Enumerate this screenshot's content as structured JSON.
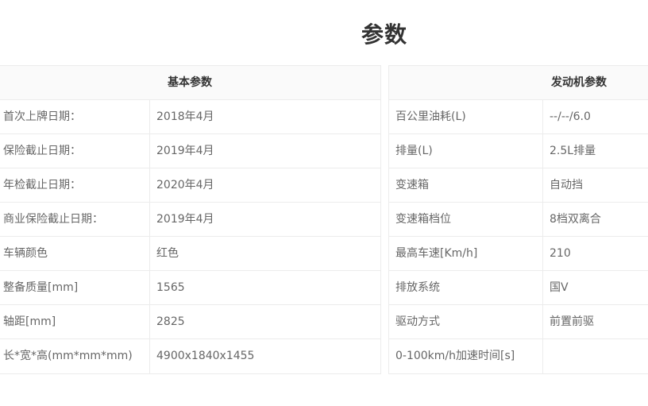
{
  "page_title": "参数",
  "basic": {
    "header": "基本参数",
    "rows": [
      {
        "label": "首次上牌日期：",
        "value": "2018年4月"
      },
      {
        "label": "保险截止日期：",
        "value": "2019年4月"
      },
      {
        "label": "年检截止日期：",
        "value": "2020年4月"
      },
      {
        "label": "商业保险截止日期：",
        "value": "2019年4月"
      },
      {
        "label": "车辆颜色",
        "value": "红色"
      },
      {
        "label": "整备质量[mm]",
        "value": "1565"
      },
      {
        "label": "轴距[mm]",
        "value": "2825"
      },
      {
        "label": "长*宽*高(mm*mm*mm)",
        "value": "4900x1840x1455"
      }
    ]
  },
  "engine": {
    "header": "发动机参数",
    "rows": [
      {
        "label": "百公里油耗(L)",
        "value": "--/--/6.0"
      },
      {
        "label": "排量(L)",
        "value": "2.5L排量"
      },
      {
        "label": "变速箱",
        "value": "自动挡"
      },
      {
        "label": "变速箱档位",
        "value": "8档双离合"
      },
      {
        "label": "最高车速[Km/h]",
        "value": "210"
      },
      {
        "label": "排放系统",
        "value": "国V"
      },
      {
        "label": "驱动方式",
        "value": "前置前驱"
      },
      {
        "label": "0-100km/h加速时间[s]",
        "value": ""
      }
    ]
  }
}
